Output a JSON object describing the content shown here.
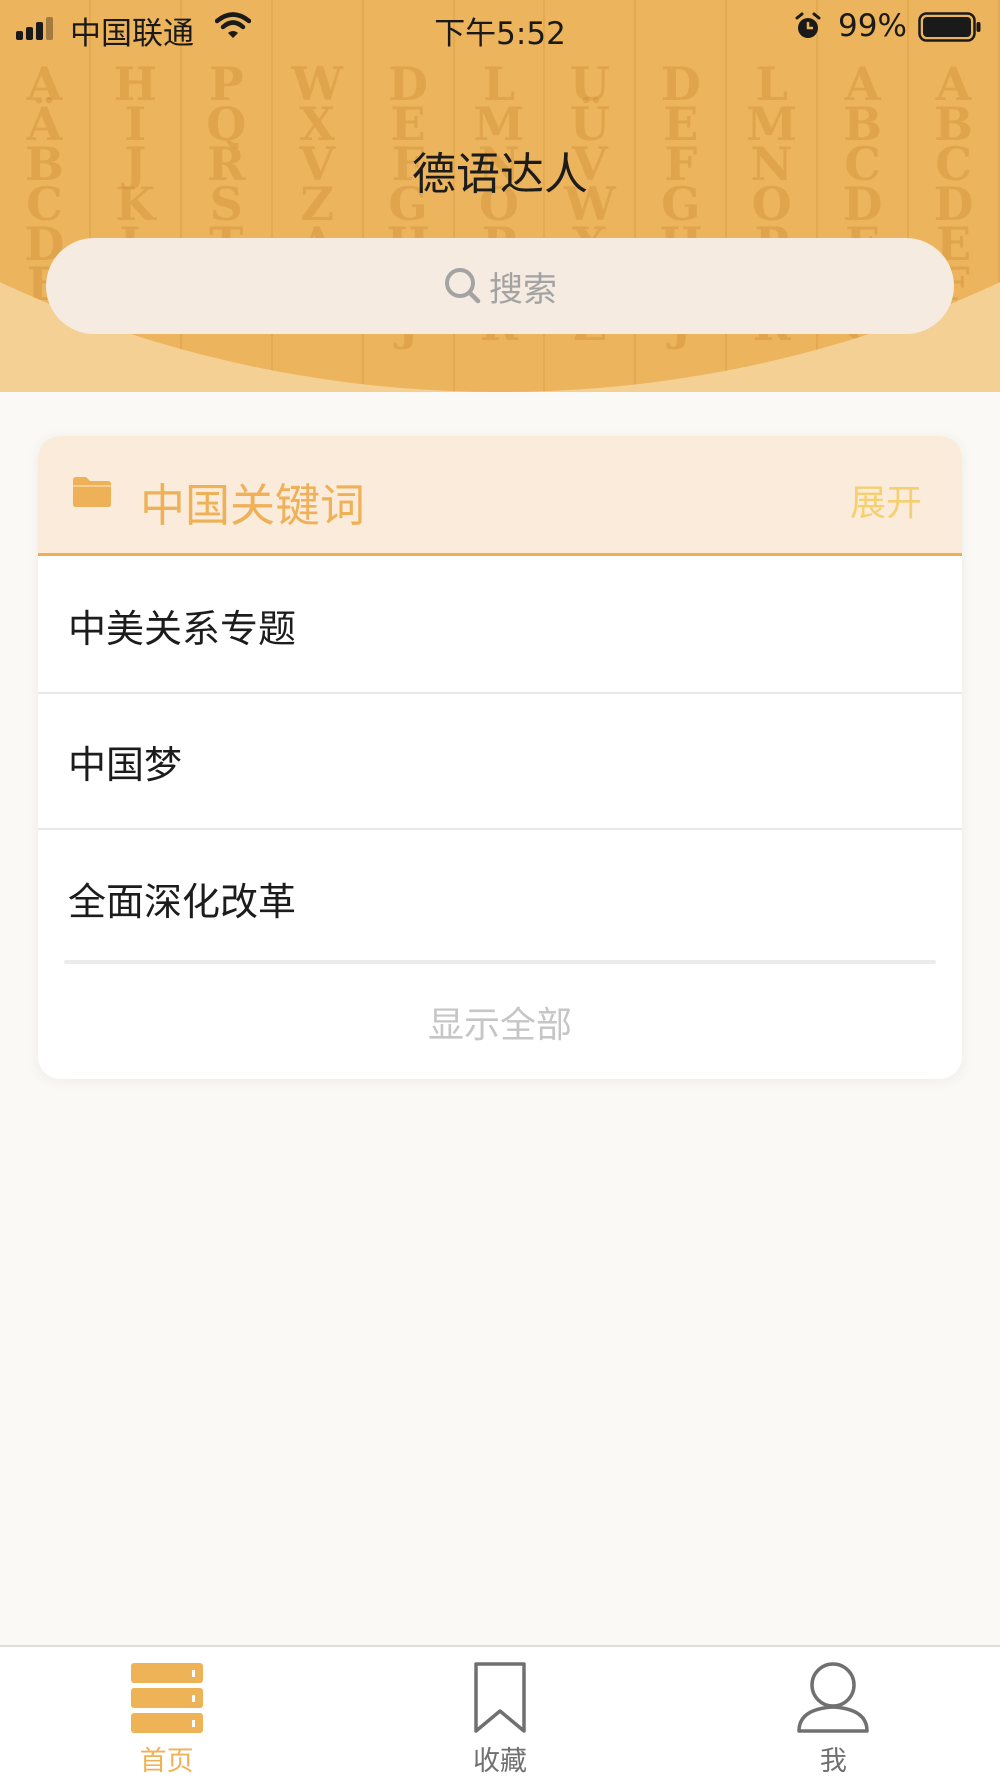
{
  "status_bar": {
    "carrier": "中国联通",
    "time": "下午5:52",
    "battery": "99%"
  },
  "header": {
    "background_letter_columns": [
      "AÄBCDEF",
      "HIJKL",
      "PQRST",
      "WXVZA",
      "DEFGHIJ",
      "LMNOPQR",
      "UÜVWXYZ",
      "DEFGHIJ",
      "LMNOPQR",
      "ABCDEFG",
      "ABCDEFG"
    ],
    "title": "德语达人",
    "search_placeholder": "搜索"
  },
  "card": {
    "title": "中国关键词",
    "expand_label": "展开",
    "items": [
      {
        "label": "中美关系专题"
      },
      {
        "label": "中国梦"
      },
      {
        "label": "全面深化改革"
      }
    ],
    "show_all_label": "显示全部"
  },
  "tab_bar": {
    "tabs": [
      {
        "label": "首页",
        "icon": "home-stack-icon",
        "active": true
      },
      {
        "label": "收藏",
        "icon": "bookmark-icon",
        "active": false
      },
      {
        "label": "我",
        "icon": "user-icon",
        "active": false
      }
    ]
  },
  "colors": {
    "accent": "#eeb257",
    "header_light": "#f4d095",
    "header_main": "#ecb45c",
    "card_header_bg": "#fbebdb"
  }
}
